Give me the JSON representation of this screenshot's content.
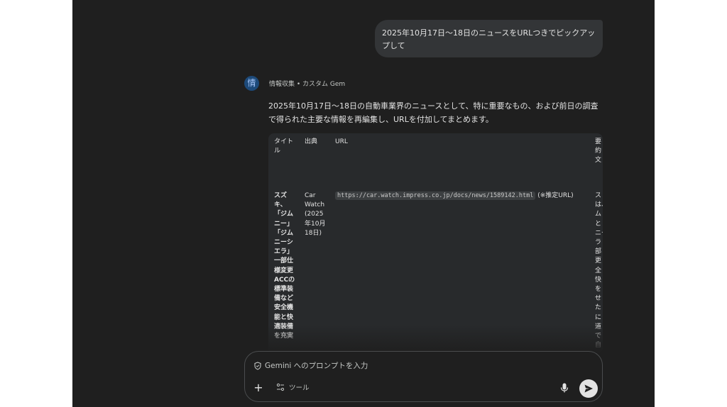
{
  "user_message": "2025年10月17日〜18日のニュースをURLつきでピックアップして",
  "response": {
    "avatar_char": "情",
    "gem_label": "情報収集 • カスタム Gem",
    "intro": "2025年10月17日〜18日の自動車業界のニュースとして、特に重要なもの、および前日の調査で得られた主要な情報を再編集し、URLを付加してまとめます。",
    "table": {
      "headers": {
        "title": "タイトル",
        "source": "出典",
        "url": "URL",
        "summary": "要約文"
      },
      "row1": {
        "title": "スズキ、「ジムニー」「ジムニーシエラ」一部仕様変更 ACCの標準装備など安全機能と快適装備を充実",
        "source": "Car Watch (2025年10月18日)",
        "url_code": "https://car.watch.impress.co.jp/docs/news/1589142.html",
        "url_note": "(※推定URL)",
        "summary_lines": [
          "ス",
          "は、",
          "ム",
          "と",
          "ニー",
          "ラ",
          "部",
          "更",
          "全",
          "快",
          "を",
          "せ",
          "た",
          "に",
          "道",
          "で",
          "自"
        ]
      }
    }
  },
  "input": {
    "placeholder": "Gemini へのプロンプトを入力",
    "plus_label": "+",
    "tools_label": "ツール"
  },
  "colors": {
    "background": "#1f1f1f",
    "bubble": "#333537",
    "table": "#282a2c",
    "send": "#e3e3e3"
  },
  "icons": [
    "shield-icon",
    "plus-icon",
    "tools-icon",
    "mic-icon",
    "send-icon"
  ]
}
